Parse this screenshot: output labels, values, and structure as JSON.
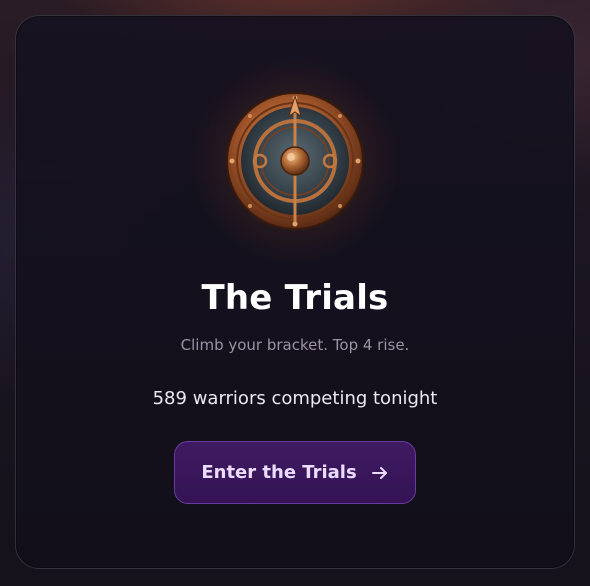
{
  "card": {
    "title": "The Trials",
    "subtitle": "Climb your bracket. Top 4 rise.",
    "status": "589 warriors competing tonight",
    "cta_label": "Enter the Trials",
    "cta_icon": "arrow-right-icon",
    "emblem_icon": "shield-spear-emblem-icon"
  },
  "colors": {
    "accent": "#3f1a62",
    "accent_border": "#6a3aa0",
    "text_primary": "#ffffff",
    "text_muted": "#9a94a6",
    "emblem_bronze": "#b86a38"
  }
}
